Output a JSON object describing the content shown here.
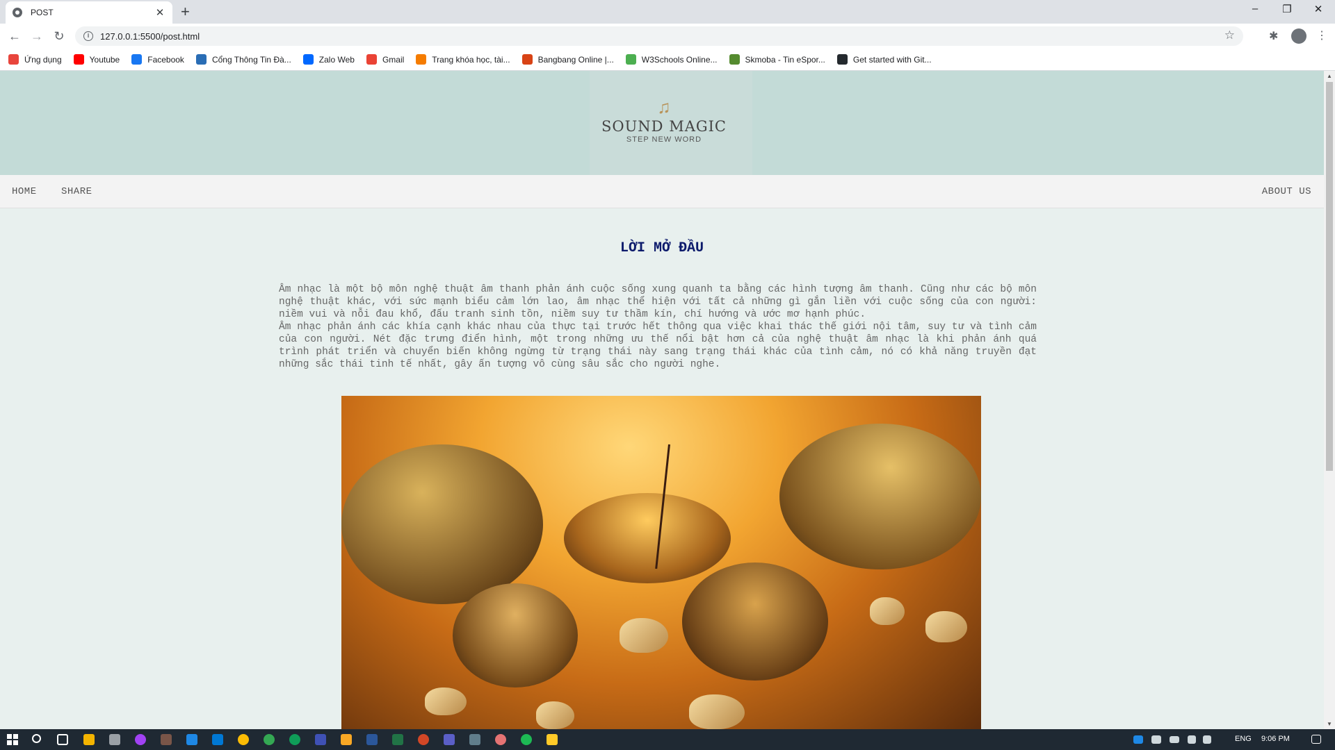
{
  "browser": {
    "tab_title": "POST",
    "tab_close": "✕",
    "new_tab": "+",
    "url": "127.0.0.1:5500/post.html",
    "window_controls": {
      "minimize": "–",
      "restore": "❐",
      "close": "✕"
    },
    "nav_icons": {
      "back": "←",
      "forward": "→",
      "reload": "↻",
      "star": "☆",
      "extensions": "✱",
      "menu": "⋮"
    },
    "bookmarks": [
      {
        "label": "Ứng dụng",
        "icon": "apps-grid-icon",
        "color": "#e8453c"
      },
      {
        "label": "Youtube",
        "icon": "youtube-icon",
        "color": "#ff0000"
      },
      {
        "label": "Facebook",
        "icon": "facebook-icon",
        "color": "#1877f2"
      },
      {
        "label": "Cổng Thông Tin Đà...",
        "icon": "portal-icon",
        "color": "#2a6db5"
      },
      {
        "label": "Zalo Web",
        "icon": "zalo-icon",
        "color": "#0068ff"
      },
      {
        "label": "Gmail",
        "icon": "gmail-icon",
        "color": "#ea4335"
      },
      {
        "label": "Trang khóa học, tài...",
        "icon": "course-icon",
        "color": "#f57c00"
      },
      {
        "label": "Bangbang Online |...",
        "icon": "bangbang-icon",
        "color": "#d84315"
      },
      {
        "label": "W3Schools Online...",
        "icon": "w3schools-icon",
        "color": "#4caf50"
      },
      {
        "label": "Skmoba - Tin eSpor...",
        "icon": "skmoba-icon",
        "color": "#558b2f"
      },
      {
        "label": "Get started with Git...",
        "icon": "github-icon",
        "color": "#24292e"
      }
    ]
  },
  "site": {
    "logo_icon": "♫",
    "brand": "SOUND MAGIC",
    "tagline": "STEP NEW WORD",
    "nav": {
      "home": "HOME",
      "share": "SHARE",
      "about": "ABOUT US"
    }
  },
  "article": {
    "title": "LỜI MỞ ĐẦU",
    "paragraph1": "Âm nhạc là một bộ môn nghệ thuật âm thanh phản ánh cuộc sống xung quanh ta bằng các hình tượng âm thanh. Cũng như các bộ môn nghệ thuật khác, với sức mạnh biểu cảm lớn lao, âm nhạc thể hiện với tất cả những gì gắn liền với cuộc sống của con người: niềm vui và nỗi đau khổ, đấu tranh sinh tồn, niềm suy tư thầm kín, chí hướng và ước mơ hạnh phúc.",
    "paragraph2": "Âm nhạc phản ánh các khía cạnh khác nhau của thực tại trước hết thông qua việc khai thác thế giới nội tâm, suy tư và tình cảm của con người. Nét đặc trưng điển hình, một trong những ưu thế nổi bật hơn cả của nghệ thuật âm nhạc là khi phản ánh quá trình phát triển và chuyển biến không ngừng từ trạng thái này sang trạng thái khác của tình cảm, nó có khả năng truyền đạt những sắc thái tinh tế nhất, gây ấn tượng vô cùng sâu sắc cho người nghe."
  },
  "taskbar": {
    "language": "ENG",
    "time": "9:06 PM"
  }
}
